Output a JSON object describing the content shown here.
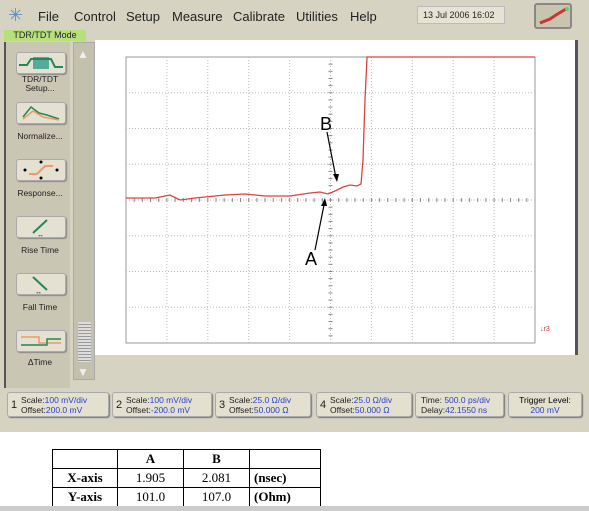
{
  "menu": {
    "items": [
      "File",
      "Control",
      "Setup",
      "Measure",
      "Calibrate",
      "Utilities",
      "Help"
    ],
    "date": "13 Jul 2006  16:02"
  },
  "mode_label": "TDR/TDT Mode",
  "sidebar": {
    "items": [
      {
        "label": "TDR/TDT Setup...",
        "icon": "tdr-setup-icon"
      },
      {
        "label": "Normalize...",
        "icon": "normalize-icon"
      },
      {
        "label": "Response...",
        "icon": "response-icon"
      },
      {
        "label": "Rise Time",
        "icon": "rise-time-icon"
      },
      {
        "label": "Fall Time",
        "icon": "fall-time-icon"
      },
      {
        "label": "ΔTime",
        "icon": "delta-time-icon"
      }
    ]
  },
  "plot": {
    "trace_color": "#d9443f",
    "marker_label": "r3",
    "annotations": [
      "A",
      "B"
    ]
  },
  "channels": [
    {
      "num": "1",
      "scale": "100 mV/div",
      "offset": "200.0 mV"
    },
    {
      "num": "2",
      "scale": "100 mV/div",
      "offset": "-200.0 mV"
    },
    {
      "num": "3",
      "scale": "25.0 Ω/div",
      "offset": "50.000 Ω"
    },
    {
      "num": "4",
      "scale": "25.0 Ω/div",
      "offset": "50.000 Ω"
    }
  ],
  "labels": {
    "scale": "Scale:",
    "offset": "Offset:",
    "time": "Time:",
    "delay": "Delay:",
    "trigger": "Trigger Level:"
  },
  "timebase": {
    "time": "500.0 ps/div",
    "delay": "42.1550 ns"
  },
  "trigger": {
    "level": "200 mV"
  },
  "table": {
    "headers": [
      "",
      "A",
      "B",
      ""
    ],
    "rows": [
      [
        "X-axis",
        "1.905",
        "2.081",
        "(nsec)"
      ],
      [
        "Y-axis",
        "101.0",
        "107.0",
        "(Ohm)"
      ]
    ]
  }
}
